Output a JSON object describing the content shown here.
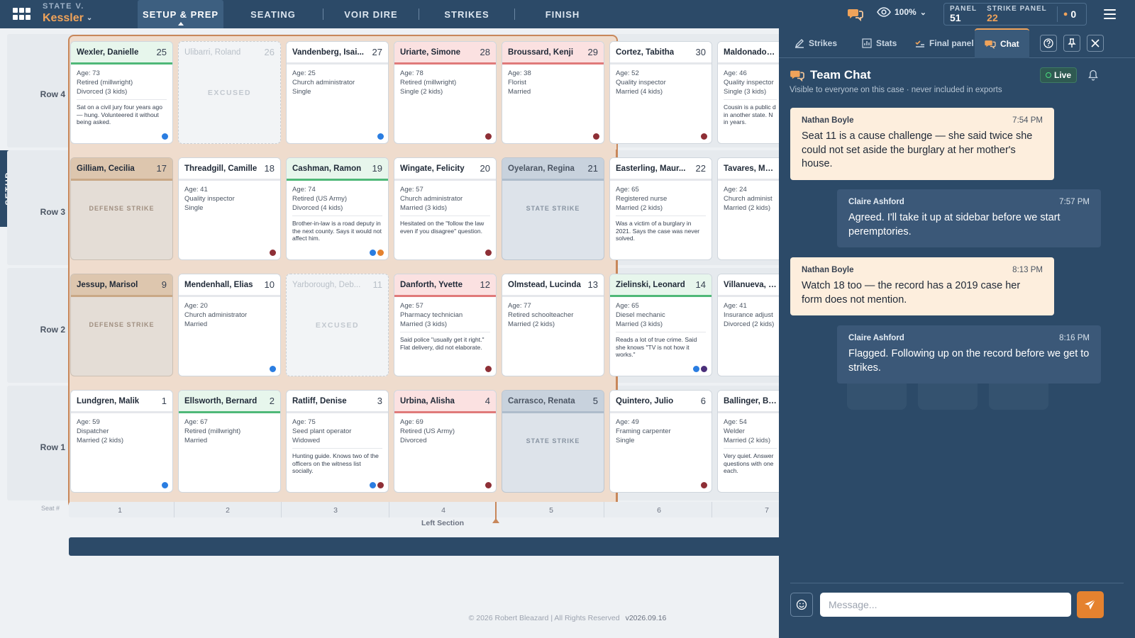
{
  "header": {
    "case_prefix": "STATE V.",
    "case_name": "Kessler",
    "nav": [
      "SETUP & PREP",
      "SEATING",
      "VOIR DIRE",
      "STRIKES",
      "FINISH"
    ],
    "zoom": "100%",
    "panel_label": "PANEL",
    "panel_value": "51",
    "strike_panel_label": "STRIKE PANEL",
    "strike_panel_value": "22",
    "pending_count": "0"
  },
  "side_tab": "SETUP",
  "rows": [
    "Row 4",
    "Row 3",
    "Row 2",
    "Row 1"
  ],
  "jurors": {
    "row4": [
      {
        "name": "Wexler, Danielle",
        "seat": "25",
        "age": "Age: 73",
        "occupation": "Retired (millwright)",
        "family": "Divorced (3 kids)",
        "note": "Sat on a civil jury four years ago — hung. Volunteered it without being asked."
      },
      {
        "name": "Ulibarri, Roland",
        "seat": "26",
        "status": "EXCUSED"
      },
      {
        "name": "Vandenberg, Isai...",
        "seat": "27",
        "age": "Age: 25",
        "occupation": "Church administrator",
        "family": "Single"
      },
      {
        "name": "Uriarte, Simone",
        "seat": "28",
        "age": "Age: 78",
        "occupation": "Retired (millwright)",
        "family": "Single (2 kids)"
      },
      {
        "name": "Broussard, Kenji",
        "seat": "29",
        "age": "Age: 38",
        "occupation": "Florist",
        "family": "Married"
      },
      {
        "name": "Cortez, Tabitha",
        "seat": "30",
        "age": "Age: 52",
        "occupation": "Quality inspector",
        "family": "Married (4 kids)"
      },
      {
        "name": "Maldonado, Co",
        "seat": "",
        "age": "Age: 46",
        "occupation": "Quality inspector",
        "family": "Single (3 kids)",
        "note": "Cousin is a public d in another state. N in years."
      }
    ],
    "row3": [
      {
        "name": "Gilliam, Cecilia",
        "seat": "17",
        "status": "DEFENSE STRIKE"
      },
      {
        "name": "Threadgill, Camille",
        "seat": "18",
        "age": "Age: 41",
        "occupation": "Quality inspector",
        "family": "Single"
      },
      {
        "name": "Cashman, Ramon",
        "seat": "19",
        "age": "Age: 74",
        "occupation": "Retired (US Army)",
        "family": "Divorced (4 kids)",
        "note": "Brother-in-law is a road deputy in the next county. Says it would not affect him."
      },
      {
        "name": "Wingate, Felicity",
        "seat": "20",
        "age": "Age: 57",
        "occupation": "Church administrator",
        "family": "Married (3 kids)",
        "note": "Hesitated on the \"follow the law even if you disagree\" question."
      },
      {
        "name": "Oyelaran, Regina",
        "seat": "21",
        "status": "STATE STRIKE"
      },
      {
        "name": "Easterling, Maur...",
        "seat": "22",
        "age": "Age: 65",
        "occupation": "Registered nurse",
        "family": "Married (2 kids)",
        "note": "Was a victim of a burglary in 2021. Says the case was never solved."
      },
      {
        "name": "Tavares, Marcy",
        "seat": "",
        "age": "Age: 24",
        "occupation": "Church administ",
        "family": "Married (2 kids)"
      }
    ],
    "row2": [
      {
        "name": "Jessup, Marisol",
        "seat": "9",
        "status": "DEFENSE STRIKE"
      },
      {
        "name": "Mendenhall, Elias",
        "seat": "10",
        "age": "Age: 20",
        "occupation": "Church administrator",
        "family": "Married"
      },
      {
        "name": "Yarborough, Deb...",
        "seat": "11",
        "status": "EXCUSED"
      },
      {
        "name": "Danforth, Yvette",
        "seat": "12",
        "age": "Age: 57",
        "occupation": "Pharmacy technician",
        "family": "Married (3 kids)",
        "note": "Said police \"usually get it right.\" Flat delivery, did not elaborate."
      },
      {
        "name": "Olmstead, Lucinda",
        "seat": "13",
        "age": "Age: 77",
        "occupation": "Retired schoolteacher",
        "family": "Married (2 kids)"
      },
      {
        "name": "Zielinski, Leonard",
        "seat": "14",
        "age": "Age: 65",
        "occupation": "Diesel mechanic",
        "family": "Married (3 kids)",
        "note": "Reads a lot of true crime. Said she knows \"TV is not how it works.\""
      },
      {
        "name": "Villanueva, Co",
        "seat": "",
        "age": "Age: 41",
        "occupation": "Insurance adjust",
        "family": "Divorced (2 kids)"
      }
    ],
    "row1": [
      {
        "name": "Lundgren, Malik",
        "seat": "1",
        "age": "Age: 59",
        "occupation": "Dispatcher",
        "family": "Married (2 kids)"
      },
      {
        "name": "Ellsworth, Bernard",
        "seat": "2",
        "age": "Age: 67",
        "occupation": "Retired (millwright)",
        "family": "Married"
      },
      {
        "name": "Ratliff, Denise",
        "seat": "3",
        "age": "Age: 75",
        "occupation": "Seed plant operator",
        "family": "Widowed",
        "note": "Hunting guide. Knows two of the officers on the witness list socially."
      },
      {
        "name": "Urbina, Alisha",
        "seat": "4",
        "age": "Age: 69",
        "occupation": "Retired (US Army)",
        "family": "Divorced"
      },
      {
        "name": "Carrasco, Renata",
        "seat": "5",
        "status": "STATE STRIKE"
      },
      {
        "name": "Quintero, Julio",
        "seat": "6",
        "age": "Age: 49",
        "occupation": "Framing carpenter",
        "family": "Single"
      },
      {
        "name": "Ballinger, Beth",
        "seat": "",
        "age": "Age: 54",
        "occupation": "Welder",
        "family": "Married (2 kids)",
        "note": "Very quiet. Answer questions with one each."
      }
    ]
  },
  "seat_axis": {
    "label": "Seat #",
    "numbers": [
      "1",
      "2",
      "3",
      "4",
      "5",
      "6",
      "7"
    ],
    "section": "Left Section"
  },
  "footer": {
    "copyright": "© 2026 Robert Bleazard | All Rights Reserved",
    "version": "v2026.09.16"
  },
  "drawer": {
    "tabs": [
      "Strikes",
      "Stats",
      "Final panel",
      "Chat"
    ],
    "title": "Team Chat",
    "subtitle": "Visible to everyone on this case · never included in exports",
    "live": "Live",
    "messages": [
      {
        "author": "Nathan Boyle",
        "time": "7:54 PM",
        "text": "Seat 11 is a cause challenge — she said twice she could not set aside the burglary at her mother's house."
      },
      {
        "author": "Claire Ashford",
        "time": "7:57 PM",
        "text": "Agreed. I'll take it up at sidebar before we start peremptories."
      },
      {
        "author": "Nathan Boyle",
        "time": "8:13 PM",
        "text": "Watch 18 too — the record has a 2019 case her form does not mention."
      },
      {
        "author": "Claire Ashford",
        "time": "8:16 PM",
        "text": "Flagged. Following up on the record before we get to strikes."
      }
    ],
    "input_placeholder": "Message..."
  },
  "colors": {
    "navy": "#2c4a68",
    "accent_orange": "#f0a35a",
    "send_orange": "#e5822f",
    "section_outline": "#c8875a"
  }
}
